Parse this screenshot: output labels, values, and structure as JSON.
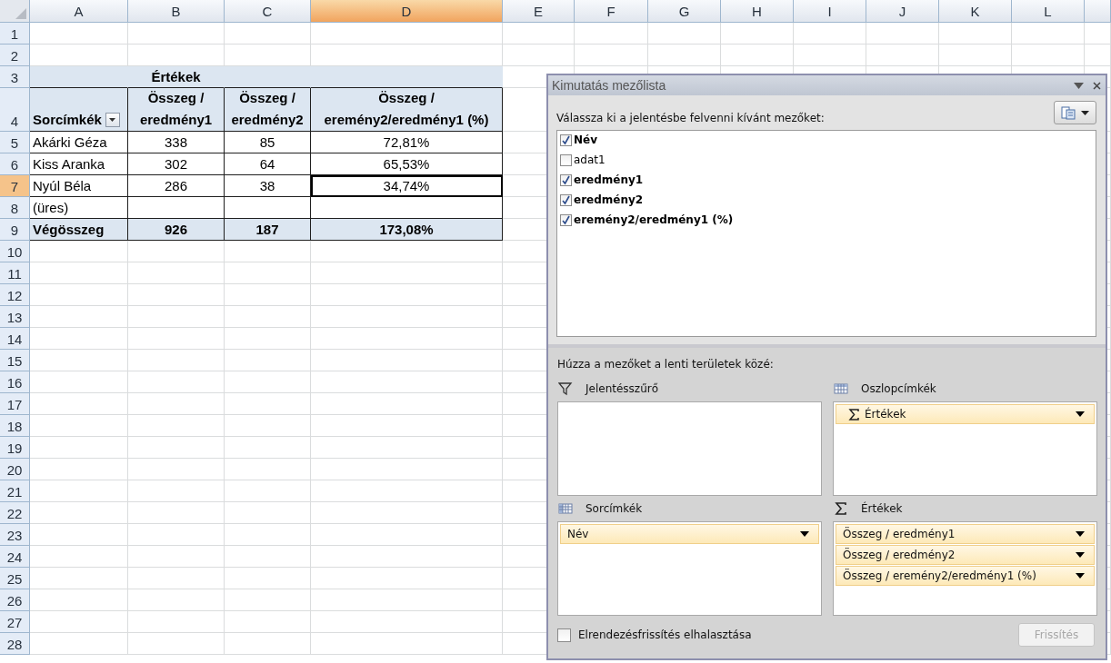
{
  "sheet": {
    "columns": [
      {
        "label": "A",
        "selected": false
      },
      {
        "label": "B",
        "selected": false
      },
      {
        "label": "C",
        "selected": false
      },
      {
        "label": "D",
        "selected": true
      },
      {
        "label": "E",
        "selected": false
      },
      {
        "label": "F",
        "selected": false
      },
      {
        "label": "G",
        "selected": false
      },
      {
        "label": "H",
        "selected": false
      },
      {
        "label": "I",
        "selected": false
      },
      {
        "label": "J",
        "selected": false
      },
      {
        "label": "K",
        "selected": false
      },
      {
        "label": "L",
        "selected": false
      }
    ],
    "rows": [
      {
        "label": "1",
        "selected": false
      },
      {
        "label": "2",
        "selected": false
      },
      {
        "label": "3",
        "selected": false
      },
      {
        "label": "4",
        "selected": false
      },
      {
        "label": "5",
        "selected": false
      },
      {
        "label": "6",
        "selected": false
      },
      {
        "label": "7",
        "selected": true
      },
      {
        "label": "8",
        "selected": false
      },
      {
        "label": "9",
        "selected": false
      },
      {
        "label": "10",
        "selected": false
      },
      {
        "label": "11",
        "selected": false
      },
      {
        "label": "12",
        "selected": false
      },
      {
        "label": "13",
        "selected": false
      },
      {
        "label": "14",
        "selected": false
      },
      {
        "label": "15",
        "selected": false
      },
      {
        "label": "16",
        "selected": false
      },
      {
        "label": "17",
        "selected": false
      },
      {
        "label": "18",
        "selected": false
      },
      {
        "label": "19",
        "selected": false
      },
      {
        "label": "20",
        "selected": false
      },
      {
        "label": "21",
        "selected": false
      },
      {
        "label": "22",
        "selected": false
      },
      {
        "label": "23",
        "selected": false
      },
      {
        "label": "24",
        "selected": false
      },
      {
        "label": "25",
        "selected": false
      },
      {
        "label": "26",
        "selected": false
      },
      {
        "label": "27",
        "selected": false
      },
      {
        "label": "28",
        "selected": false
      }
    ]
  },
  "pivot_table": {
    "title": "Értékek",
    "header": [
      "Sorcímkék",
      "Összeg / eredmény1",
      "Összeg / eredmény2",
      "Összeg / eremény2/eredmény1 (%)"
    ],
    "rows": [
      {
        "kind": "data",
        "cells": [
          {
            "text": "Akárki Géza",
            "selected": false
          },
          {
            "text": "338",
            "selected": false
          },
          {
            "text": "85",
            "selected": false
          },
          {
            "text": "72,81%",
            "selected": false
          }
        ]
      },
      {
        "kind": "data",
        "cells": [
          {
            "text": "Kiss Aranka",
            "selected": false
          },
          {
            "text": "302",
            "selected": false
          },
          {
            "text": "64",
            "selected": false
          },
          {
            "text": "65,53%",
            "selected": false
          }
        ]
      },
      {
        "kind": "data",
        "cells": [
          {
            "text": "Nyúl Béla",
            "selected": false
          },
          {
            "text": "286",
            "selected": false
          },
          {
            "text": "38",
            "selected": false
          },
          {
            "text": "34,74%",
            "selected": true
          }
        ]
      },
      {
        "kind": "data",
        "cells": [
          {
            "text": "(üres)",
            "selected": false
          }
        ]
      },
      {
        "kind": "total",
        "cells": [
          {
            "text": "Végösszeg",
            "selected": false
          },
          {
            "text": "926",
            "selected": false
          },
          {
            "text": "187",
            "selected": false
          },
          {
            "text": "173,08%",
            "selected": false
          }
        ]
      }
    ]
  },
  "field_list": {
    "title": "Kimutatás mezőlista",
    "instruction": "Válassza ki a jelentésbe felvenni kívánt mezőket:",
    "fields": [
      {
        "label": "Név",
        "checked": true
      },
      {
        "label": "adat1",
        "checked": false
      },
      {
        "label": "eredmény1",
        "checked": true
      },
      {
        "label": "eredmény2",
        "checked": true
      },
      {
        "label": "eremény2/eredmény1 (%)",
        "checked": true
      }
    ],
    "areas_instruction": "Húzza a mezőket a lenti területek közé:",
    "areas": [
      {
        "kind": "filter",
        "label": "Jelentésszűrő"
      },
      {
        "kind": "columns",
        "label": "Oszlopcímkék",
        "items": [
          {
            "label": "Értékek",
            "kind": "values"
          }
        ]
      },
      {
        "kind": "rows",
        "label": "Sorcímkék",
        "items": [
          {
            "label": "Név",
            "kind": "field"
          }
        ]
      },
      {
        "kind": "values",
        "label": "Értékek",
        "items": [
          {
            "label": "Összeg / eredmény1",
            "kind": "field"
          },
          {
            "label": "Összeg / eredmény2",
            "kind": "field"
          },
          {
            "label": "Összeg / eremény2/eredmény1 (%)",
            "kind": "field"
          }
        ]
      }
    ],
    "defer_update": {
      "label": "Elrendezésfrissítés elhalasztása",
      "checked": false
    },
    "update_button": {
      "label": "Frissítés",
      "disabled": true
    }
  }
}
